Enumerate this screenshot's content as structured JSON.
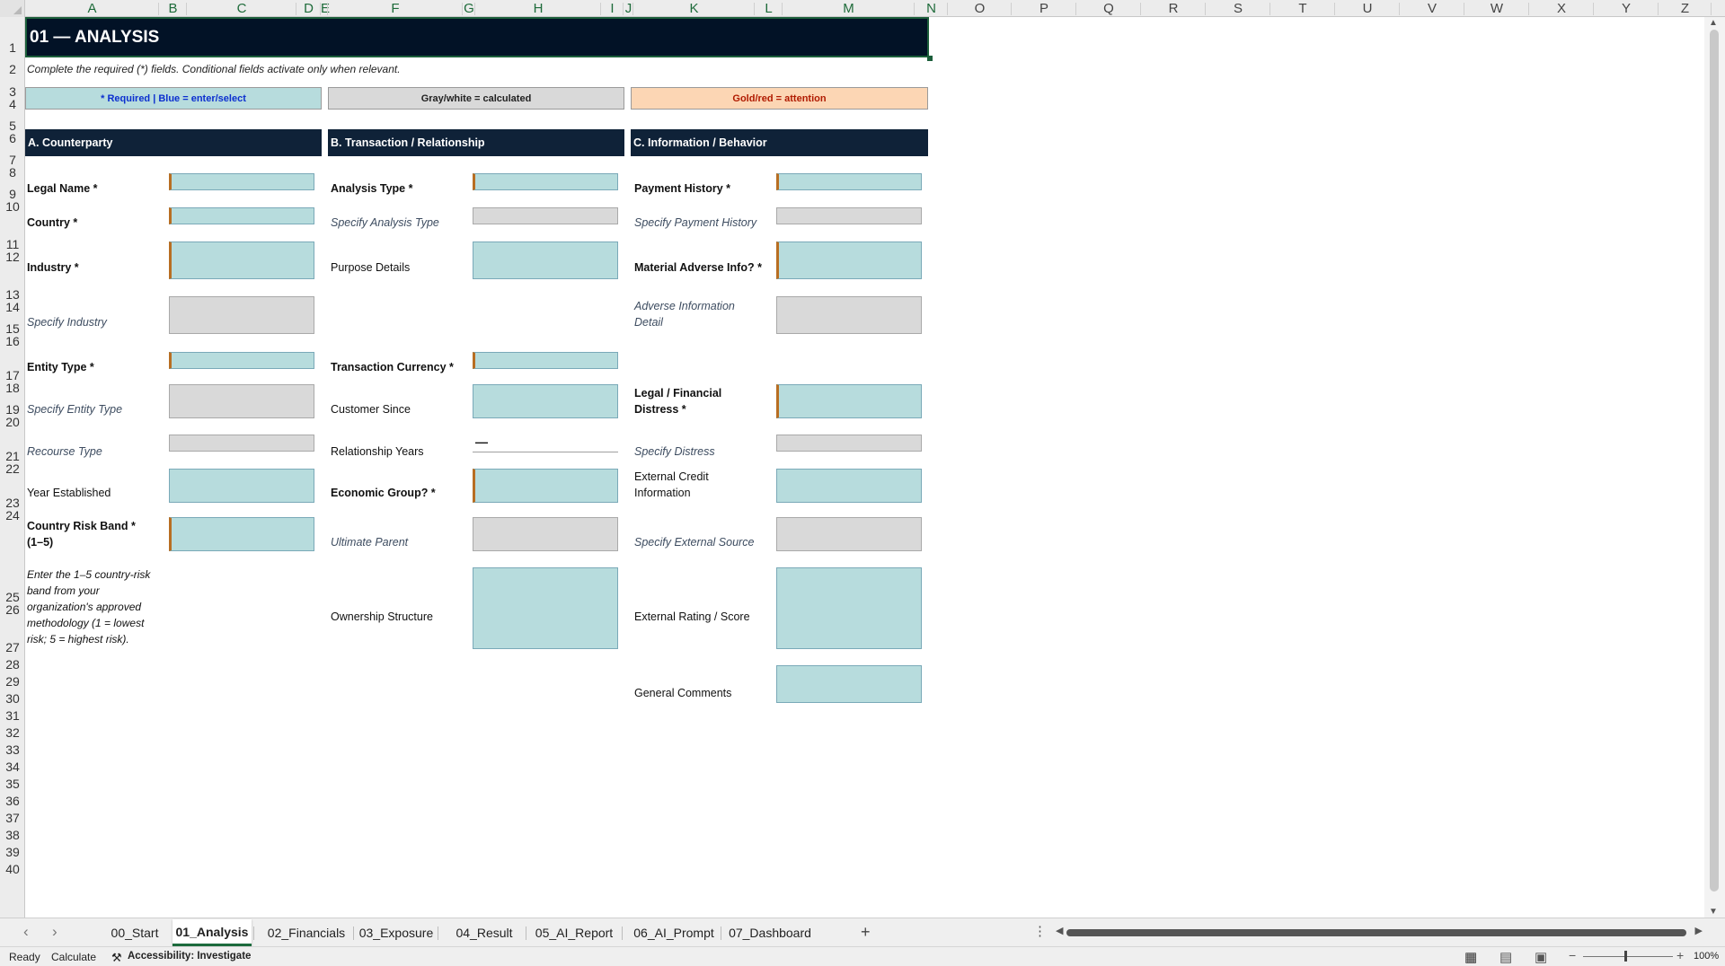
{
  "columns": [
    "A",
    "B",
    "C",
    "D",
    "E",
    "F",
    "G",
    "H",
    "I",
    "J",
    "K",
    "L",
    "M",
    "N",
    "O",
    "P",
    "Q",
    "R",
    "S",
    "T",
    "U",
    "V",
    "W",
    "X",
    "Y",
    "Z"
  ],
  "rows": [
    "1",
    "2",
    "3",
    "4",
    "5",
    "6",
    "7",
    "8",
    "9",
    "10",
    "11",
    "12",
    "13",
    "14",
    "15",
    "16",
    "17",
    "18",
    "19",
    "20",
    "21",
    "22",
    "23",
    "24",
    "25",
    "26",
    "27",
    "28",
    "29",
    "30",
    "31",
    "32",
    "33",
    "34",
    "35",
    "36",
    "37",
    "38",
    "39",
    "40"
  ],
  "sheet": {
    "title": "01 — ANALYSIS",
    "instructions": "Complete the required (*) fields. Conditional fields activate only when relevant.",
    "legend": [
      {
        "text": "* Required | Blue = enter/select",
        "color": "#0b2fcf",
        "bg": "#b7dcdd"
      },
      {
        "text": "Gray/white = calculated",
        "color": "#222222",
        "bg": "#d9d9d9"
      },
      {
        "text": "Gold/red = attention",
        "color": "#b01a00",
        "bg": "#fcd6b4"
      }
    ],
    "sections": {
      "a": "A. Counterparty",
      "b": "B. Transaction / Relationship",
      "c": "C. Information / Behavior"
    },
    "a_fields": {
      "legal_name": "Legal Name *",
      "country": "Country *",
      "industry": "Industry *",
      "specify_industry": "Specify Industry",
      "entity_type": "Entity Type *",
      "specify_entity_type": "Specify Entity Type",
      "recourse_type": "Recourse Type",
      "year_established": "Year Established",
      "country_risk_band": "Country Risk Band * (1–5)",
      "country_risk_help": "Enter the 1–5 country-risk band from your organization's approved methodology (1 = lowest risk; 5 = highest risk)."
    },
    "b_fields": {
      "analysis_type": "Analysis Type *",
      "specify_analysis_type": "Specify Analysis Type",
      "purpose_details": "Purpose Details",
      "transaction_currency": "Transaction Currency *",
      "customer_since": "Customer Since",
      "relationship_years": "Relationship Years",
      "relationship_years_value": "—",
      "economic_group": "Economic Group? *",
      "ultimate_parent": "Ultimate Parent",
      "ownership_structure": "Ownership Structure"
    },
    "c_fields": {
      "payment_history": "Payment History *",
      "specify_payment_history": "Specify Payment History",
      "material_adverse_info": "Material Adverse Info? *",
      "adverse_info_detail": "Adverse Information Detail",
      "legal_financial_distress": "Legal / Financial Distress *",
      "specify_distress": "Specify Distress",
      "external_credit_info": "External Credit Information",
      "specify_external_source": "Specify External Source",
      "external_rating": "External Rating / Score",
      "general_comments": "General Comments"
    }
  },
  "tabs": [
    "00_Start",
    "01_Analysis",
    "02_Financials",
    "03_Exposure",
    "04_Result",
    "05_AI_Report",
    "06_AI_Prompt",
    "07_Dashboard"
  ],
  "active_tab": "01_Analysis",
  "add_sheet": "+",
  "status": {
    "ready": "Ready",
    "calculate": "Calculate",
    "accessibility": "Accessibility: Investigate",
    "zoom": "100%"
  }
}
